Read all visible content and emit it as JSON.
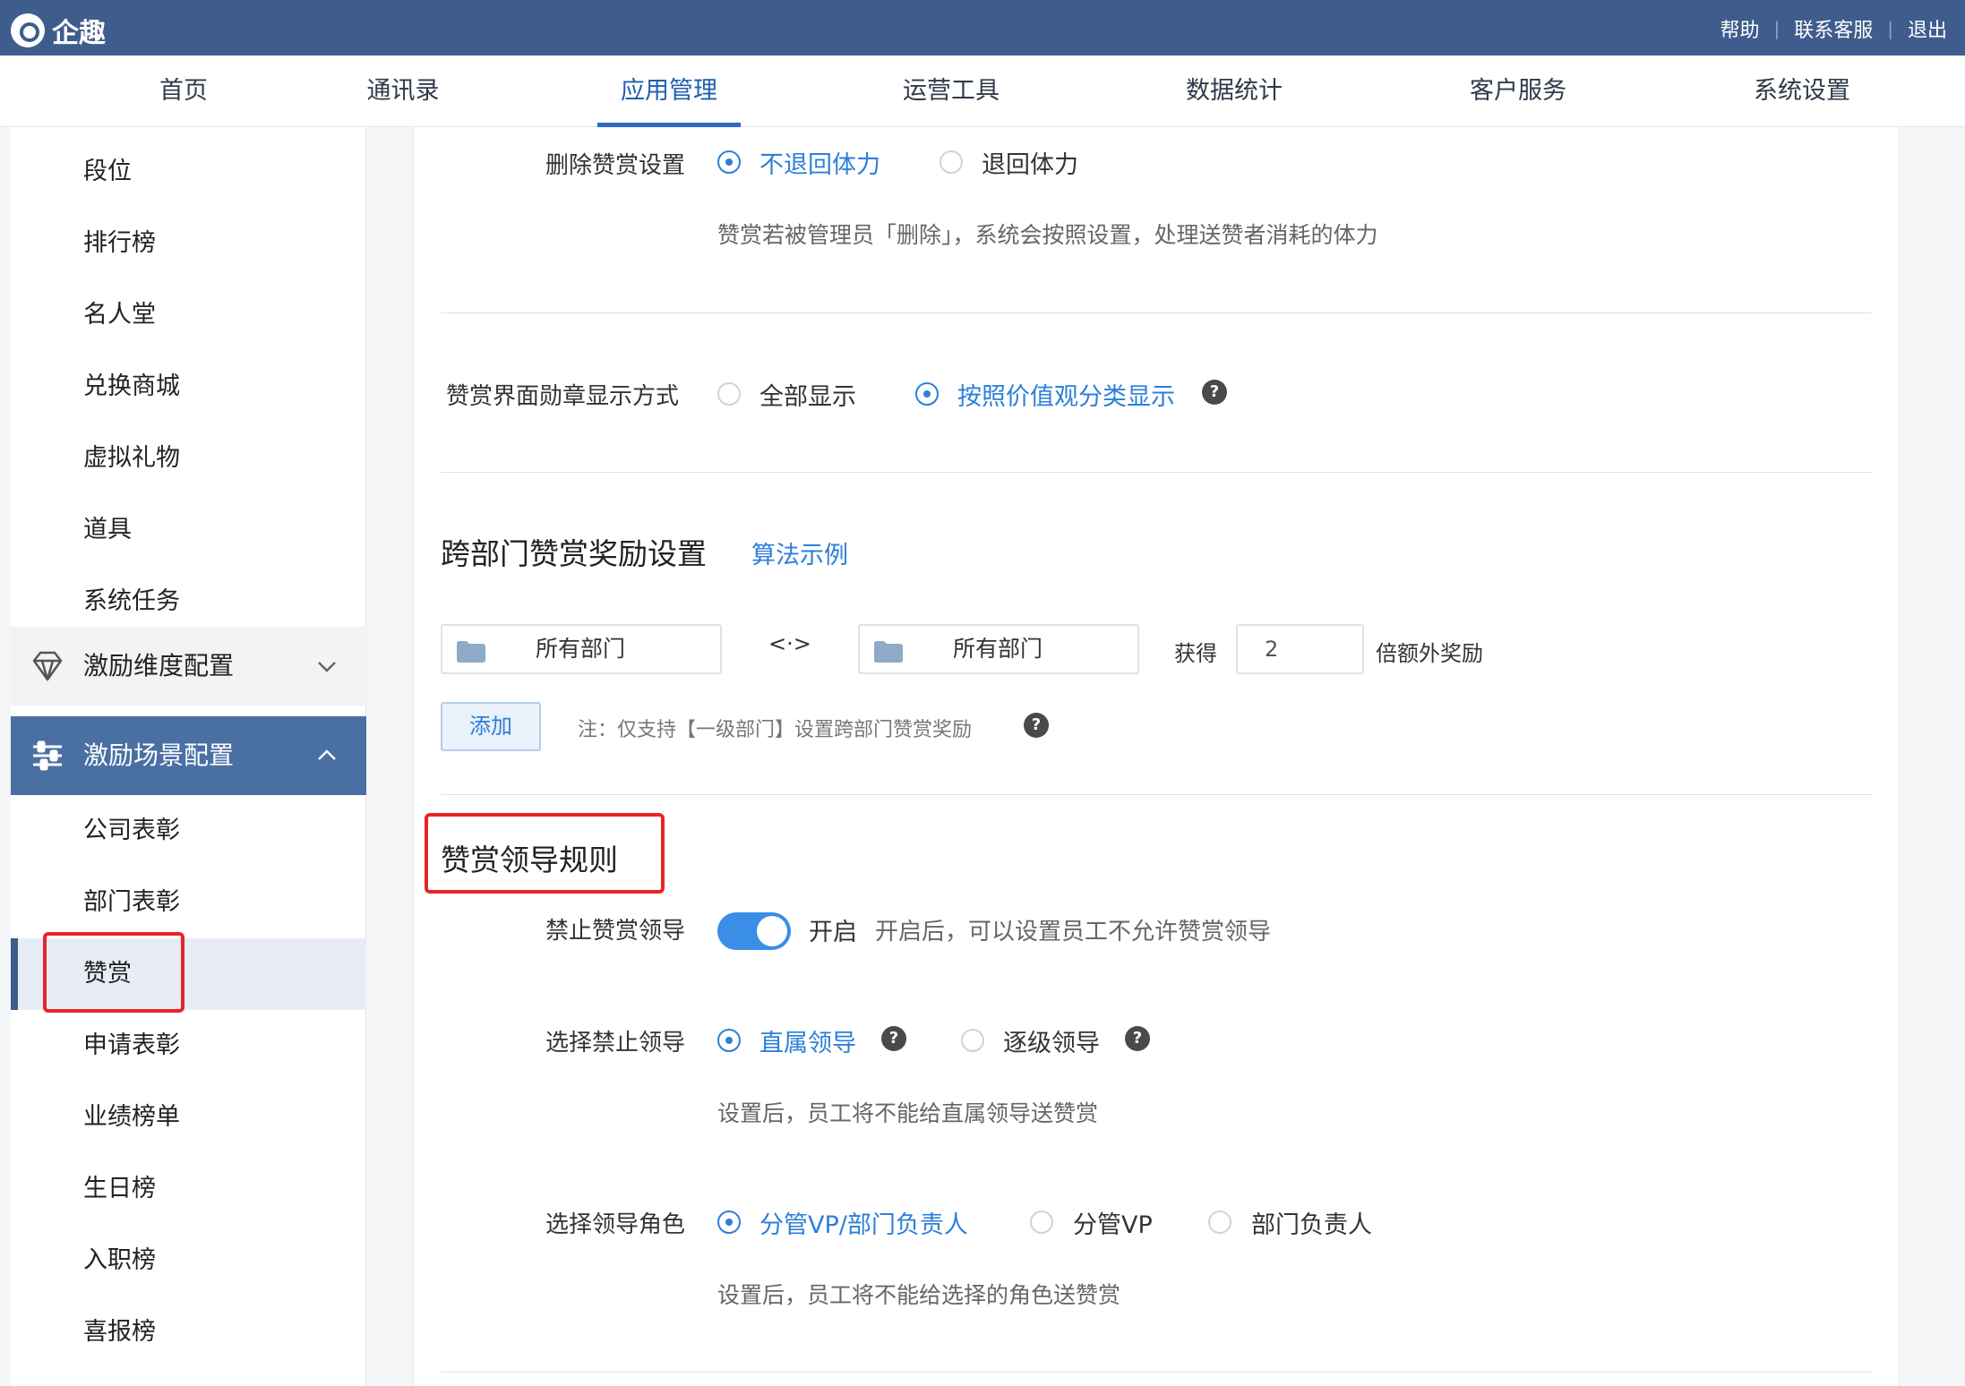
{
  "app": {
    "logo_text": "企趣"
  },
  "top_links": [
    "帮助",
    "联系客服",
    "退出"
  ],
  "nav": [
    "首页",
    "通讯录",
    "应用管理",
    "运营工具",
    "数据统计",
    "客户服务",
    "系统设置"
  ],
  "nav_active": "应用管理",
  "sidebar": {
    "items_top": [
      "段位",
      "排行榜",
      "名人堂",
      "兑换商城",
      "虚拟礼物",
      "道具",
      "系统任务"
    ],
    "group_collapsed": "激励维度配置",
    "group_expanded": "激励场景配置",
    "items_sub": [
      "公司表彰",
      "部门表彰",
      "赞赏",
      "申请表彰",
      "业绩榜单",
      "生日榜",
      "入职榜",
      "喜报榜"
    ],
    "active": "赞赏"
  },
  "delete_setting": {
    "label": "删除赞赏设置",
    "options": [
      "不退回体力",
      "退回体力"
    ],
    "selected": "不退回体力",
    "hint": "赞赏若被管理员「删除」，系统会按照设置，处理送赞者消耗的体力"
  },
  "badge_display": {
    "label": "赞赏界面勋章显示方式",
    "options": [
      "全部显示",
      "按照价值观分类显示"
    ],
    "selected": "按照价值观分类显示"
  },
  "cross_dept": {
    "title": "跨部门赞赏奖励设置",
    "example_link": "算法示例",
    "from_dept": "所有部门",
    "arrow": "<·>",
    "to_dept": "所有部门",
    "get_label": "获得",
    "multiplier": "2",
    "suffix": "倍额外奖励",
    "add_button": "添加",
    "note": "注：仅支持【一级部门】设置跨部门赞赏奖励"
  },
  "leader_rule": {
    "title": "赞赏领导规则",
    "forbid_label": "禁止赞赏领导",
    "toggle_state": "开启",
    "toggle_hint": "开启后，可以设置员工不允许赞赏领导",
    "select_leader_label": "选择禁止领导",
    "leader_options": [
      "直属领导",
      "逐级领导"
    ],
    "leader_selected": "直属领导",
    "leader_hint": "设置后，员工将不能给直属领导送赞赏",
    "role_label": "选择领导角色",
    "role_options": [
      "分管VP/部门负责人",
      "分管VP",
      "部门负责人"
    ],
    "role_selected": "分管VP/部门负责人",
    "role_hint": "设置后，员工将不能给选择的角色送赞赏"
  },
  "colors": {
    "topbar": "#3e5d8d",
    "accent": "#2d7fd8",
    "highlight": "#e8232a"
  }
}
